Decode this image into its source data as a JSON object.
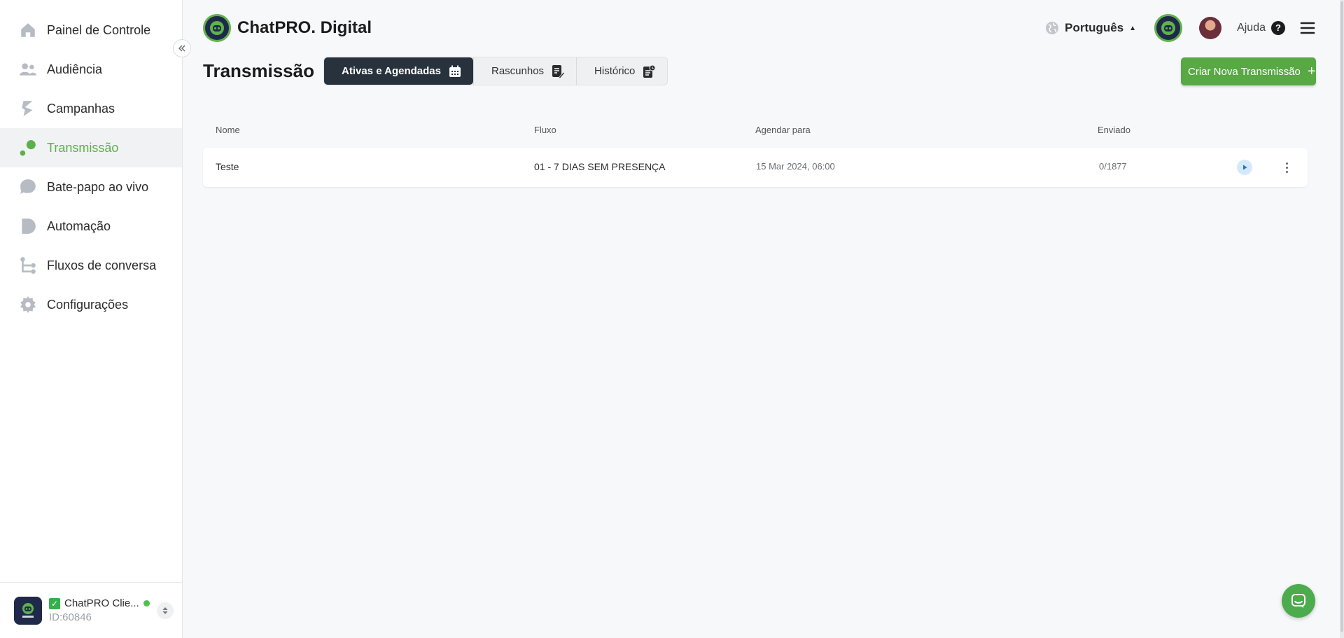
{
  "brand": {
    "name": "ChatPRO. Digital",
    "logo_icon": "chat-robot-logo"
  },
  "sidebar": {
    "items": [
      {
        "label": "Painel de Controle",
        "icon": "home-icon",
        "active": false
      },
      {
        "label": "Audiência",
        "icon": "people-icon",
        "active": false
      },
      {
        "label": "Campanhas",
        "icon": "campaign-icon",
        "active": false
      },
      {
        "label": "Transmissão",
        "icon": "broadcast-icon",
        "active": true
      },
      {
        "label": "Bate-papo ao vivo",
        "icon": "chat-bubble-icon",
        "active": false
      },
      {
        "label": "Automação",
        "icon": "automation-icon",
        "active": false
      },
      {
        "label": "Fluxos de conversa",
        "icon": "flow-icon",
        "active": false
      },
      {
        "label": "Configurações",
        "icon": "gear-icon",
        "active": false
      }
    ],
    "account": {
      "name": "ChatPRO Clie...",
      "id": "ID:60846",
      "logo_text": "ChatPRO"
    }
  },
  "header": {
    "language": "Português",
    "help_label": "Ajuda"
  },
  "page": {
    "title": "Transmissão",
    "tabs": [
      {
        "label": "Ativas e Agendadas",
        "icon": "calendar-icon",
        "active": true
      },
      {
        "label": "Rascunhos",
        "icon": "draft-icon",
        "active": false
      },
      {
        "label": "Histórico",
        "icon": "history-icon",
        "active": false
      }
    ],
    "create_button": "Criar Nova Transmissão"
  },
  "table": {
    "columns": [
      "Nome",
      "Fluxo",
      "Agendar para",
      "Enviado"
    ],
    "rows": [
      {
        "nome": "Teste",
        "fluxo": "01 - 7 DIAS SEM PRESENÇA",
        "agendar": "15 Mar 2024, 06:00",
        "enviado": "0/1877"
      }
    ]
  },
  "colors": {
    "accent": "#58a844",
    "active_text": "#5cb04a",
    "dark_tab": "#27323d",
    "brand_navy": "#1f2a4a"
  }
}
